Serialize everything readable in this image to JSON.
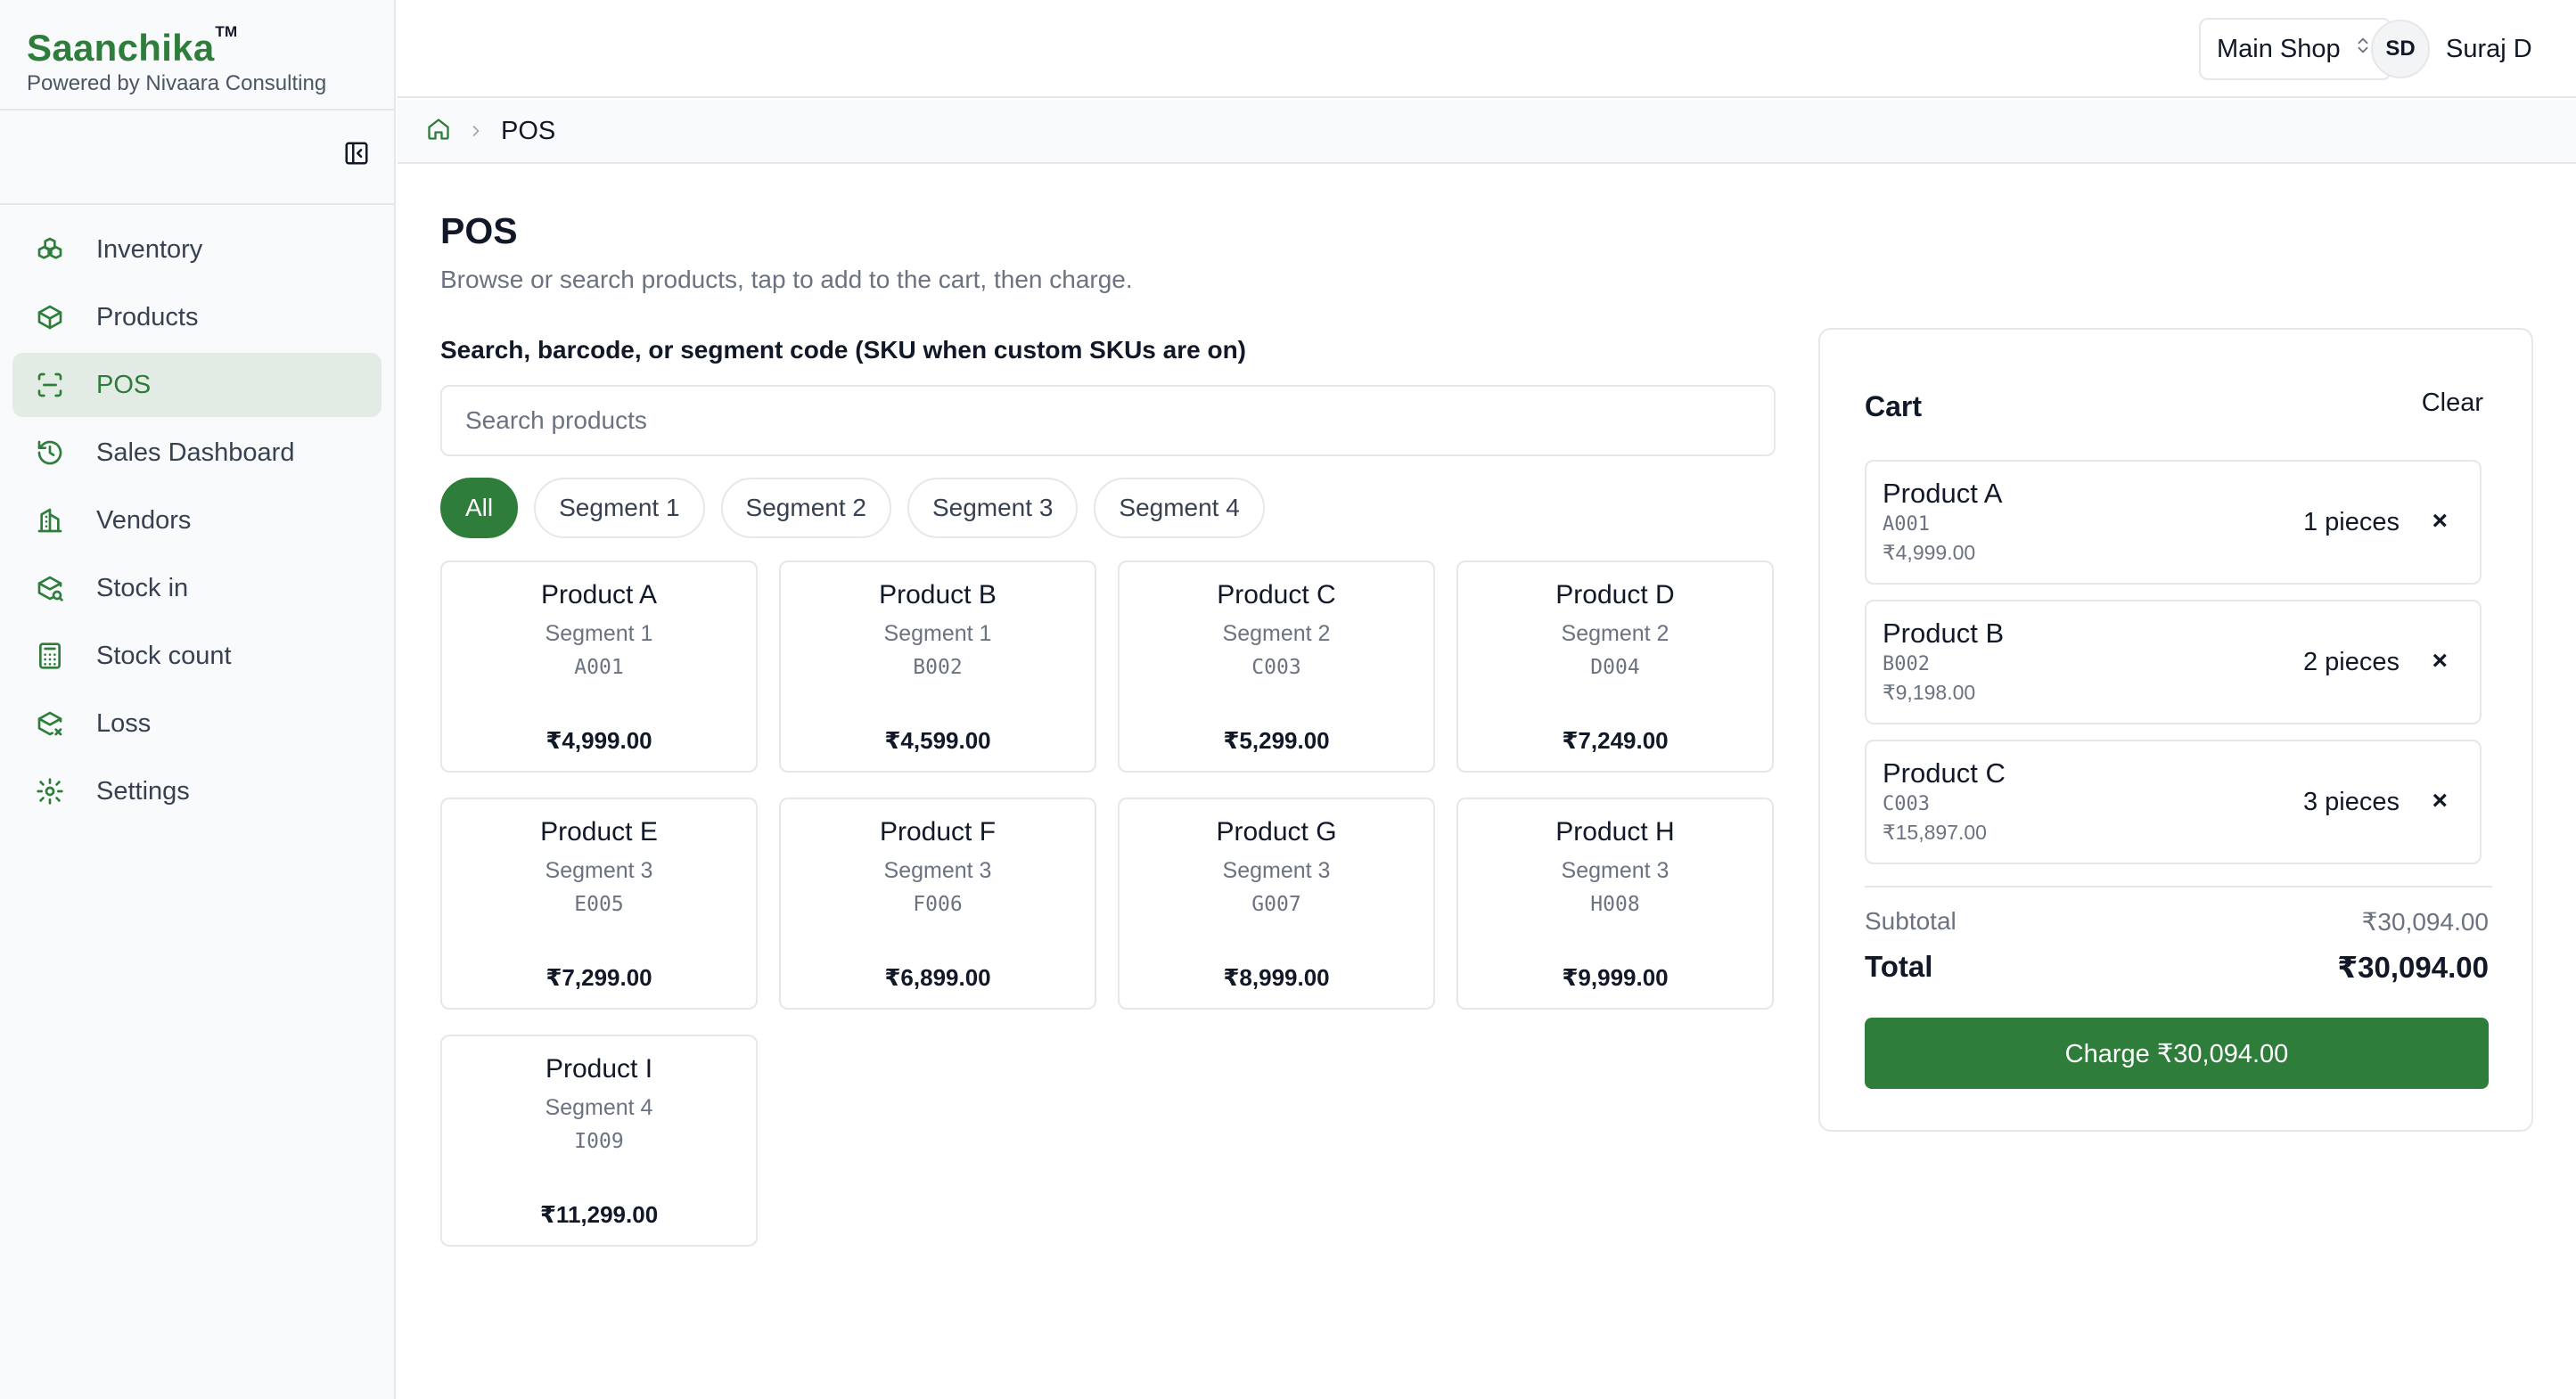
{
  "brand": {
    "name": "Saanchika",
    "tm": "TM",
    "subtitle": "Powered by Nivaara Consulting"
  },
  "colors": {
    "accent": "#2e7d3a",
    "active_nav_bg": "#e3ece4",
    "border": "#e5e7eb",
    "muted_text": "#6b7280"
  },
  "sidebar": {
    "items": [
      {
        "label": "Inventory",
        "icon": "boxes-icon",
        "active": false
      },
      {
        "label": "Products",
        "icon": "package-icon",
        "active": false
      },
      {
        "label": "POS",
        "icon": "scan-icon",
        "active": true
      },
      {
        "label": "Sales Dashboard",
        "icon": "history-icon",
        "active": false
      },
      {
        "label": "Vendors",
        "icon": "building-icon",
        "active": false
      },
      {
        "label": "Stock in",
        "icon": "package-search-icon",
        "active": false
      },
      {
        "label": "Stock count",
        "icon": "calculator-icon",
        "active": false
      },
      {
        "label": "Loss",
        "icon": "package-x-icon",
        "active": false
      },
      {
        "label": "Settings",
        "icon": "gear-icon",
        "active": false
      }
    ]
  },
  "topbar": {
    "shop": "Main Shop",
    "user_initials": "SD",
    "user_name": "Suraj D"
  },
  "breadcrumb": {
    "current": "POS"
  },
  "page": {
    "title": "POS",
    "subtitle": "Browse or search products, tap to add to the cart, then charge.",
    "search_label": "Search, barcode, or segment code (SKU when custom SKUs are on)",
    "search_placeholder": "Search products",
    "search_value": ""
  },
  "filters": [
    {
      "label": "All",
      "active": true
    },
    {
      "label": "Segment 1",
      "active": false
    },
    {
      "label": "Segment 2",
      "active": false
    },
    {
      "label": "Segment 3",
      "active": false
    },
    {
      "label": "Segment 4",
      "active": false
    }
  ],
  "products": [
    {
      "name": "Product A",
      "segment": "Segment 1",
      "code": "A001",
      "price": "₹4,999.00"
    },
    {
      "name": "Product B",
      "segment": "Segment 1",
      "code": "B002",
      "price": "₹4,599.00"
    },
    {
      "name": "Product C",
      "segment": "Segment 2",
      "code": "C003",
      "price": "₹5,299.00"
    },
    {
      "name": "Product D",
      "segment": "Segment 2",
      "code": "D004",
      "price": "₹7,249.00"
    },
    {
      "name": "Product E",
      "segment": "Segment 3",
      "code": "E005",
      "price": "₹7,299.00"
    },
    {
      "name": "Product F",
      "segment": "Segment 3",
      "code": "F006",
      "price": "₹6,899.00"
    },
    {
      "name": "Product G",
      "segment": "Segment 3",
      "code": "G007",
      "price": "₹8,999.00"
    },
    {
      "name": "Product H",
      "segment": "Segment 3",
      "code": "H008",
      "price": "₹9,999.00"
    },
    {
      "name": "Product I",
      "segment": "Segment 4",
      "code": "I009",
      "price": "₹11,299.00"
    }
  ],
  "cart": {
    "title": "Cart",
    "clear_label": "Clear",
    "items": [
      {
        "name": "Product A",
        "code": "A001",
        "price": "₹4,999.00",
        "qty": "1 pieces"
      },
      {
        "name": "Product B",
        "code": "B002",
        "price": "₹9,198.00",
        "qty": "2 pieces"
      },
      {
        "name": "Product C",
        "code": "C003",
        "price": "₹15,897.00",
        "qty": "3 pieces"
      }
    ],
    "remove_symbol": "×",
    "subtotal_label": "Subtotal",
    "subtotal_value": "₹30,094.00",
    "total_label": "Total",
    "total_value": "₹30,094.00",
    "charge_label": "Charge ₹30,094.00"
  }
}
